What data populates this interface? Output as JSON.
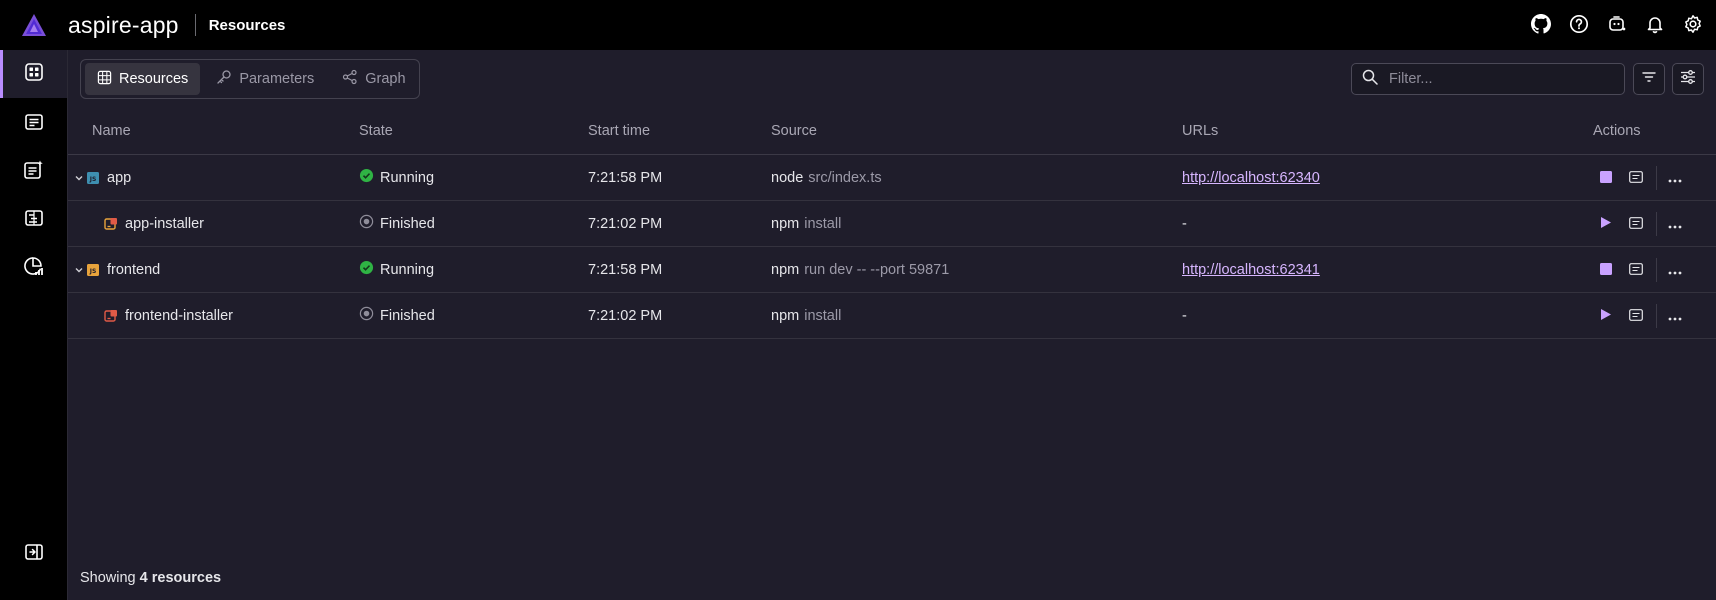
{
  "app": {
    "title": "aspire-app",
    "page": "Resources"
  },
  "colors": {
    "accent": "#b98cff",
    "running": "#2fb344",
    "link": "#d7b6ff"
  },
  "header_icons": [
    "github-icon",
    "help-icon",
    "copilot-icon",
    "notifications-icon",
    "settings-icon"
  ],
  "sidebar": {
    "items": [
      "resources",
      "console-logs",
      "structured-logs",
      "traces",
      "metrics"
    ],
    "collapse": "collapse-sidebar"
  },
  "tabs": [
    {
      "label": "Resources",
      "icon": "grid-icon",
      "active": true
    },
    {
      "label": "Parameters",
      "icon": "key-icon",
      "active": false
    },
    {
      "label": "Graph",
      "icon": "graph-icon",
      "active": false
    }
  ],
  "filter": {
    "placeholder": "Filter..."
  },
  "table": {
    "headers": {
      "name": "Name",
      "state": "State",
      "start": "Start time",
      "source": "Source",
      "urls": "URLs",
      "actions": "Actions"
    },
    "rows": [
      {
        "name": "app",
        "state": "Running",
        "start": "7:21:58 PM",
        "src_cmd": "node",
        "src_args": "src/index.ts",
        "url": "http://localhost:62340"
      },
      {
        "name": "app-installer",
        "state": "Finished",
        "start": "7:21:02 PM",
        "src_cmd": "npm",
        "src_args": "install",
        "url": "-"
      },
      {
        "name": "frontend",
        "state": "Running",
        "start": "7:21:58 PM",
        "src_cmd": "npm",
        "src_args": "run dev -- --port 59871",
        "url": "http://localhost:62341"
      },
      {
        "name": "frontend-installer",
        "state": "Finished",
        "start": "7:21:02 PM",
        "src_cmd": "npm",
        "src_args": "install",
        "url": "-"
      }
    ]
  },
  "footer": {
    "prefix": "Showing",
    "count": "4 resources"
  }
}
